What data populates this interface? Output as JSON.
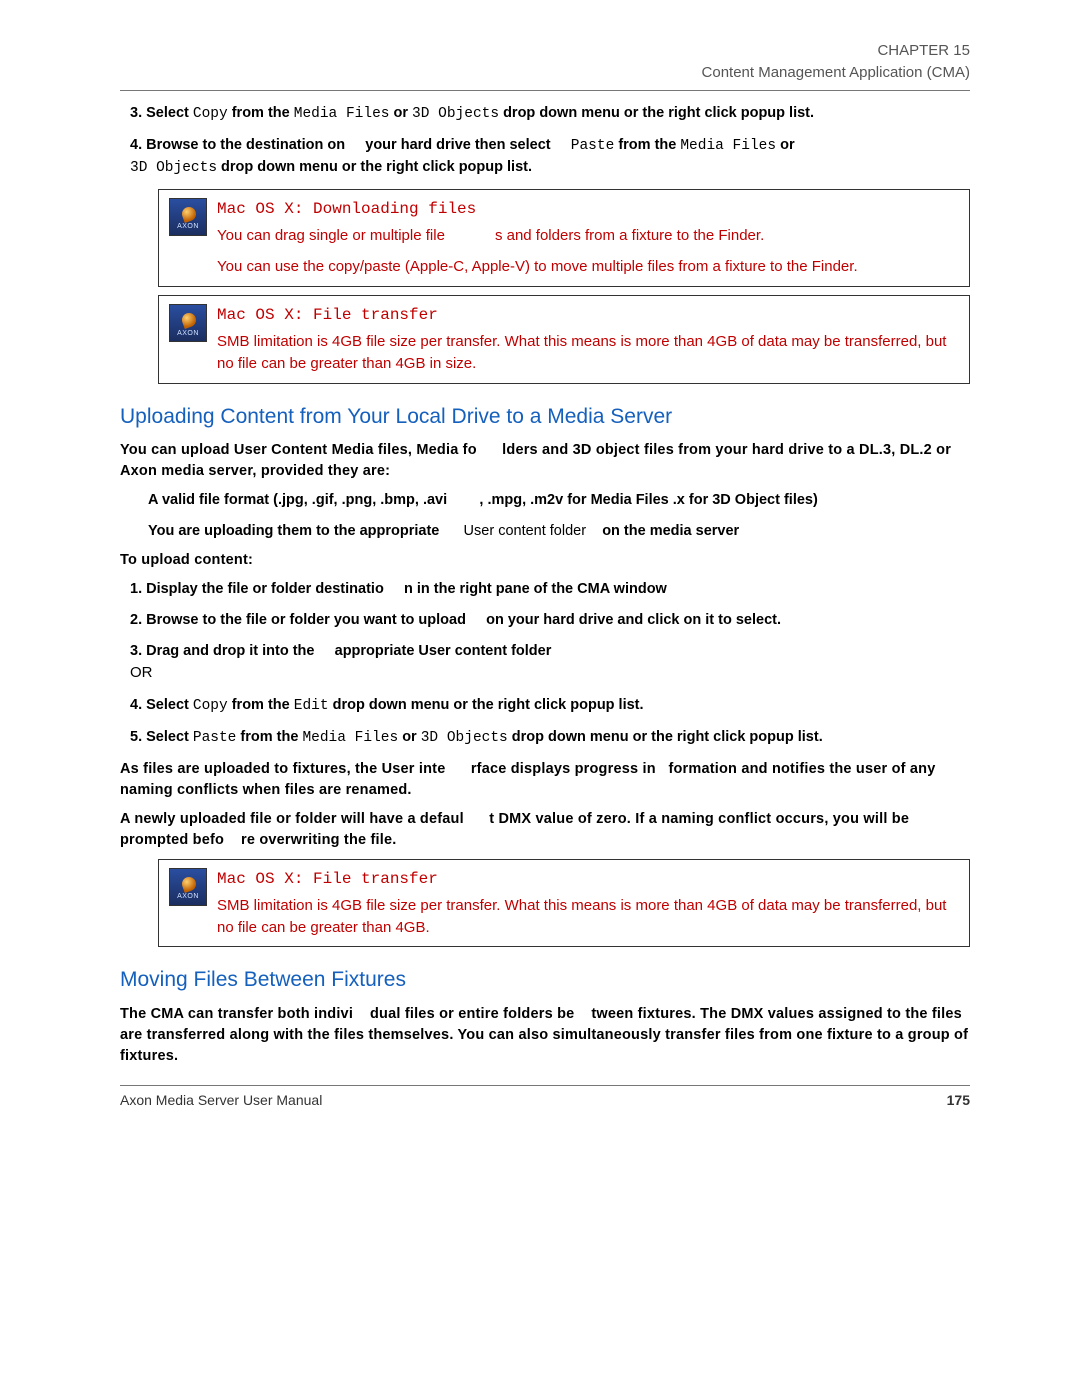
{
  "header": {
    "chapter": "CHAPTER 15",
    "title": "Content Management Application (CMA)"
  },
  "steps_top": {
    "s3": {
      "prefix": "3. Select ",
      "copy": "Copy",
      "mid1": " from the ",
      "mf": "Media Files",
      "or": " or ",
      "obj": "3D Objects",
      "tail": " drop down menu or the right click popup list."
    },
    "s4": {
      "prefix": "4. Browse to the destination on ",
      "gap": "your hard drive then select ",
      "paste": "Paste",
      "mid": " from the ",
      "mf": "Media Files",
      "or": " or",
      "obj": "3D Objects",
      "tail": " drop down menu or the right click popup list."
    }
  },
  "note1": {
    "title": "Mac OS X: Downloading files",
    "line1a": "You can drag single or multiple file",
    "line1b": "s and folders from a fixture to the Finder.",
    "line2": "You can use the copy/paste (Apple-C, Apple-V) to move multiple files from a fixture to the Finder."
  },
  "note2": {
    "title": "Mac OS X: File transfer",
    "body": "SMB limitation is 4GB file size per transfer. What this means is more than 4GB of data may be transferred, but no file can be greater than 4GB in size."
  },
  "h_upload": "Uploading Content from Your Local Drive to a Media Server",
  "upload_intro": {
    "a": "You can upload User Content Media files, Media fo",
    "b": "lders and 3D object files from your hard drive to a DL.3, DL.2 or Axon media server, provided they are:"
  },
  "bullets": {
    "b1a": "A valid file format (.jpg, .gif, .png, .bmp, .avi",
    "b1b": ", .mpg, .m2v for Media Files .x for 3D Object files)",
    "b2a": "You are uploading them to the appropriate ",
    "b2_user": "User content folder",
    "b2b": " on the media server"
  },
  "to_upload": "To upload content:",
  "steps_upload": {
    "s1a": "1. Display the file or folder destinatio",
    "s1b": "n in the right pane of the CMA window",
    "s2a": "2. Browse to the file or folder you want to upload ",
    "s2b": "on your hard drive and click on it to select.",
    "s3a": "3. Drag and drop it into the ",
    "s3b": "appropriate User content folder",
    "or": "OR",
    "s4a": "4. Select ",
    "s4copy": "Copy",
    "s4b": " from the ",
    "s4edit": "Edit",
    "s4c": " drop down menu or the right click popup list.",
    "s5a": "5. Select ",
    "s5paste": "Paste",
    "s5b": " from the ",
    "s5mf": "Media Files",
    "s5or": " or ",
    "s5obj": "3D Objects",
    "s5c": " drop down menu or the right click popup list."
  },
  "para_progress": {
    "a": "As files are uploaded to fixtures, the User inte",
    "b": "rface displays progress in",
    "c": "formation and notifies the user of any naming conflicts when files are renamed."
  },
  "para_dmx": {
    "a": "A newly uploaded file or folder will have a defaul",
    "b": "t DMX value of zero. If a naming conflict occurs, you will be prompted befo",
    "c": "re overwriting the file."
  },
  "note3": {
    "title": "Mac OS X: File transfer",
    "body": "SMB limitation is 4GB file size per transfer. What this means is more than 4GB of data may be transferred, but no file can be greater than 4GB."
  },
  "h_moving": "Moving Files Between Fixtures",
  "moving_para": {
    "a": "The CMA can transfer both indivi",
    "b": "dual files or entire folders be",
    "c": "tween fixtures. The DMX values assigned to the files are transferred along with the files themselves. You can also simultaneously transfer files from one fixture to a group of fixtures."
  },
  "footer": {
    "manual": "Axon Media Server User Manual",
    "page": "175"
  },
  "icon_label": "AXON"
}
